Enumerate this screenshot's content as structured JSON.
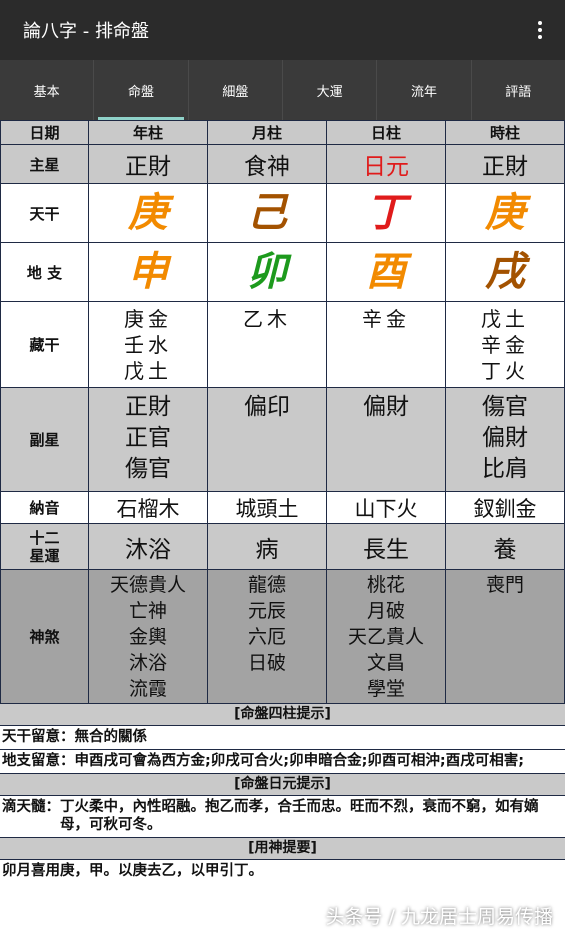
{
  "appbar": {
    "title": "論八字 - 排命盤",
    "menu_icon": "more-vert-icon"
  },
  "tabs": [
    {
      "label": "基本",
      "active": false
    },
    {
      "label": "命盤",
      "active": true
    },
    {
      "label": "細盤",
      "active": false
    },
    {
      "label": "大運",
      "active": false
    },
    {
      "label": "流年",
      "active": false
    },
    {
      "label": "評語",
      "active": false
    }
  ],
  "grid": {
    "header": [
      "日期",
      "年柱",
      "月柱",
      "日柱",
      "時柱"
    ],
    "zhuxing": {
      "label": "主星",
      "values": [
        "正財",
        "食神",
        "日元",
        "正財"
      ],
      "colors": [
        "#111111",
        "#111111",
        "#e01b1b",
        "#111111"
      ]
    },
    "tiangan": {
      "label": "天干",
      "values": [
        "庚",
        "己",
        "丁",
        "庚"
      ],
      "colors": [
        "#f28a00",
        "#a35200",
        "#e01b1b",
        "#f28a00"
      ]
    },
    "dizhi": {
      "label": "地 支",
      "values": [
        "申",
        "卯",
        "酉",
        "戌"
      ],
      "colors": [
        "#f28a00",
        "#1d9a1d",
        "#f28a00",
        "#a35200"
      ]
    },
    "canggan": {
      "label": "藏干",
      "values": [
        [
          "庚金",
          "壬水",
          "戊土"
        ],
        [
          "乙木"
        ],
        [
          "辛金"
        ],
        [
          "戊土",
          "辛金",
          "丁火"
        ]
      ]
    },
    "fuxing": {
      "label": "副星",
      "values": [
        [
          "正財",
          "正官",
          "傷官"
        ],
        [
          "偏印"
        ],
        [
          "偏財"
        ],
        [
          "傷官",
          "偏財",
          "比肩"
        ]
      ]
    },
    "nayin": {
      "label": "納音",
      "values": [
        "石榴木",
        "城頭土",
        "山下火",
        "釵釧金"
      ]
    },
    "shier": {
      "label_line1": "十二",
      "label_line2": "星運",
      "values": [
        "沐浴",
        "病",
        "長生",
        "養"
      ]
    },
    "shensha": {
      "label": "神煞",
      "values": [
        [
          "天德貴人",
          "亡神",
          "金輿",
          "沐浴",
          "流霞"
        ],
        [
          "龍德",
          "元辰",
          "六厄",
          "日破"
        ],
        [
          "桃花",
          "月破",
          "天乙貴人",
          "文昌",
          "學堂"
        ],
        [
          "喪門"
        ]
      ]
    }
  },
  "notes": {
    "sec1": "[命盤四柱提示]",
    "tiangan_key": "天干留意：",
    "tiangan_text": "無合的關係",
    "dizhi_key": "地支留意：",
    "dizhi_text": "申酉戌可會為西方金;卯戌可合火;卯申暗合金;卯酉可相沖;酉戌可相害;",
    "sec2": "[命盤日元提示]",
    "ditian_key": "滴天髓：",
    "ditian_text": "丁火柔中，內性昭融。抱乙而孝，合壬而忠。旺而不烈，衰而不窮，如有嫡母，可秋可冬。",
    "sec3": "[用神提要]",
    "yongshen_text": "卯月喜用庚，甲。以庚去乙，以甲引丁。"
  },
  "watermark": "头条号 / 九龙居士周易传播"
}
